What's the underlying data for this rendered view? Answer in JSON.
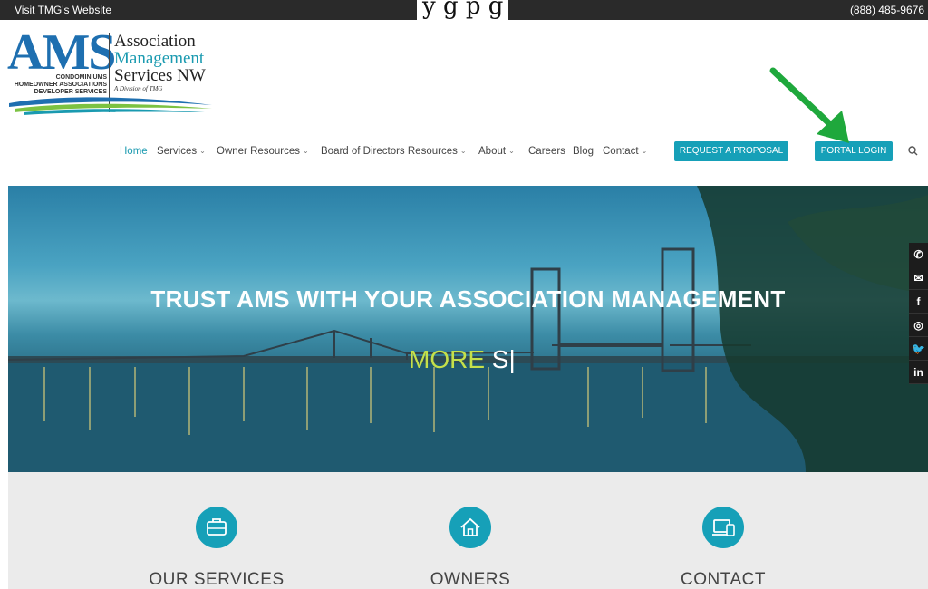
{
  "topbar": {
    "left_text": "Visit TMG's Website",
    "phone": "(888) 485-9676",
    "overflow_text": "y    g p g"
  },
  "logo": {
    "ams": "AMS",
    "tags": [
      "CONDOMINIUMS",
      "HOMEOWNER ASSOCIATIONS",
      "DEVELOPER SERVICES"
    ],
    "name": [
      "Association",
      "Management",
      "Services NW"
    ],
    "division": "A Division of TMG"
  },
  "nav": {
    "items": [
      {
        "label": "Home",
        "has_menu": false,
        "active": true
      },
      {
        "label": "Services",
        "has_menu": true
      },
      {
        "label": "Owner Resources",
        "has_menu": true
      },
      {
        "label": "Board of Directors Resources",
        "has_menu": true
      },
      {
        "label": "About",
        "has_menu": true
      },
      {
        "label": "Careers",
        "has_menu": false
      },
      {
        "label": "Blog",
        "has_menu": false
      },
      {
        "label": "Contact",
        "has_menu": true
      }
    ],
    "request_button": "REQUEST A PROPOSAL",
    "portal_button": "PORTAL LOGIN",
    "search_icon": "search-icon"
  },
  "hero": {
    "headline": "TRUST AMS WITH YOUR ASSOCIATION MANAGEMENT",
    "typed_green": "MORE",
    "typed_white": "S|"
  },
  "social": [
    "phone-icon",
    "email-icon",
    "facebook-icon",
    "instagram-icon",
    "twitter-icon",
    "linkedin-icon"
  ],
  "social_glyphs": [
    "✆",
    "✉",
    "f",
    "◎",
    "🐦",
    "in"
  ],
  "features": [
    {
      "label": "OUR SERVICES",
      "icon": "briefcase-icon"
    },
    {
      "label": "OWNERS",
      "icon": "house-icon"
    },
    {
      "label": "CONTACT",
      "icon": "devices-icon"
    }
  ],
  "colors": {
    "accent": "#16a0b8",
    "arrow": "#1fa83c",
    "topbar": "#2a2a2a",
    "gray_section": "#ebebeb"
  }
}
